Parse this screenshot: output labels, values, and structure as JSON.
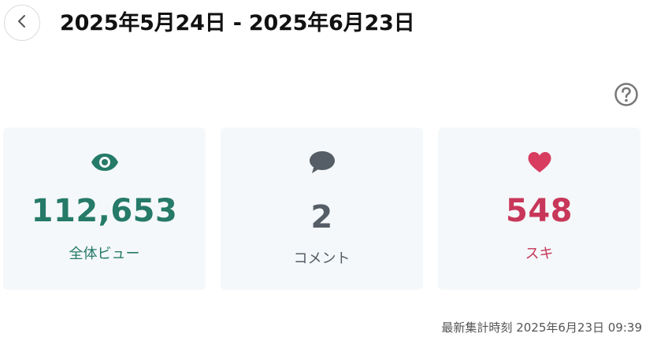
{
  "header": {
    "back_icon": "chevron-left-icon",
    "title": "2025年5月24日 - 2025年6月23日"
  },
  "help": {
    "icon": "question-circle-icon"
  },
  "stats": {
    "views": {
      "icon": "eye-icon",
      "value": "112,653",
      "label": "全体ビュー",
      "color": "#257a68"
    },
    "comments": {
      "icon": "speech-bubble-icon",
      "value": "2",
      "label": "コメント",
      "color": "#555e66"
    },
    "likes": {
      "icon": "heart-icon",
      "value": "548",
      "label": "スキ",
      "color": "#c8375a"
    }
  },
  "footer": {
    "updated_text": "最新集計時刻 2025年6月23日 09:39"
  }
}
